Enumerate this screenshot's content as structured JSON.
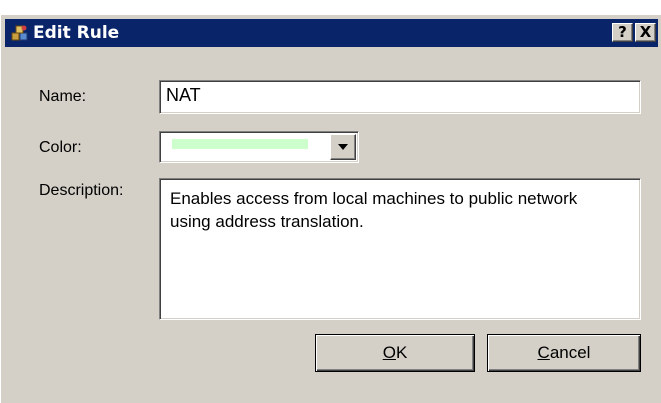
{
  "dialog": {
    "title": "Edit Rule",
    "title_icon": "rule-icon",
    "help_button": "?",
    "close_button": "X"
  },
  "form": {
    "name_label": "Name:",
    "name_value": "NAT",
    "color_label": "Color:",
    "color_value": "#ccffcc",
    "description_label": "Description:",
    "description_value": "Enables access from local machines to public network using address translation."
  },
  "buttons": {
    "ok_accel": "O",
    "ok_rest": "K",
    "cancel_accel": "C",
    "cancel_rest": "ancel"
  }
}
